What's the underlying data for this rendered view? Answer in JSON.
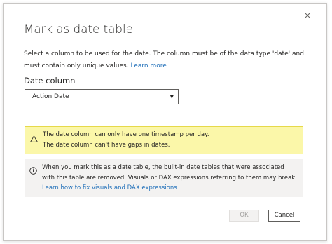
{
  "dialog": {
    "title": "Mark as date table",
    "description": "Select a column to be used for the date. The column must be of the data type 'date' and must contain only unique values.",
    "learn_more": "Learn more",
    "field_label": "Date column",
    "selected_column": "Action Date",
    "dropdown_arrow": "▼",
    "warning": {
      "line1": "The date column can only have one timestamp per day.",
      "line2": "The date column can't have gaps in dates."
    },
    "info": {
      "text": "When you mark this as a date table, the built-in date tables that were associated with this table are removed. Visuals or DAX expressions referring to them may break.",
      "link": "Learn how to fix visuals and DAX expressions"
    },
    "ok_label": "OK",
    "cancel_label": "Cancel"
  },
  "colors": {
    "link": "#1f6fb9",
    "warning_bg": "#fbf7a9",
    "info_bg": "#f3f2f1"
  },
  "icons": {
    "close": "close-icon",
    "warning": "warning-triangle-icon",
    "info": "info-circle-icon"
  }
}
